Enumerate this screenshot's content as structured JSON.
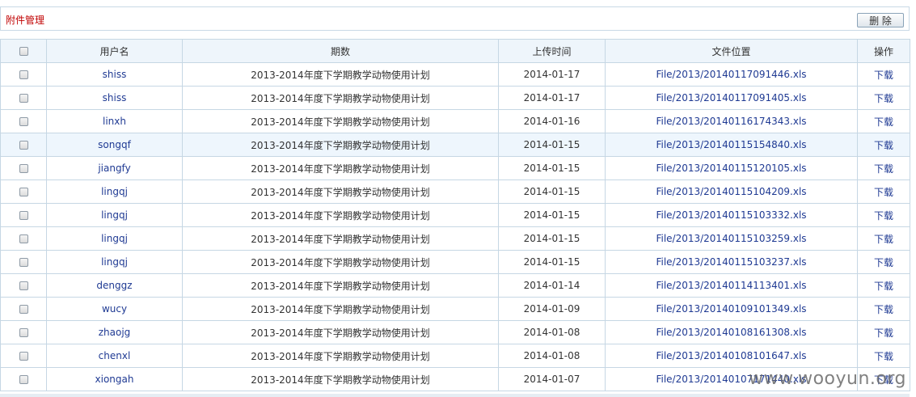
{
  "topbar": {
    "title": "附件管理",
    "delete_label": "删 除"
  },
  "table": {
    "headers": [
      "用户名",
      "期数",
      "上传时间",
      "文件位置",
      "操作"
    ],
    "rows": [
      {
        "user": "shiss",
        "period": "2013-2014年度下学期教学动物使用计划",
        "date": "2014-01-17",
        "file": "File/2013/20140117091446.xls",
        "action": "下载"
      },
      {
        "user": "shiss",
        "period": "2013-2014年度下学期教学动物使用计划",
        "date": "2014-01-17",
        "file": "File/2013/20140117091405.xls",
        "action": "下载"
      },
      {
        "user": "linxh",
        "period": "2013-2014年度下学期教学动物使用计划",
        "date": "2014-01-16",
        "file": "File/2013/20140116174343.xls",
        "action": "下载"
      },
      {
        "user": "songqf",
        "period": "2013-2014年度下学期教学动物使用计划",
        "date": "2014-01-15",
        "file": "File/2013/20140115154840.xls",
        "action": "下载"
      },
      {
        "user": "jiangfy",
        "period": "2013-2014年度下学期教学动物使用计划",
        "date": "2014-01-15",
        "file": "File/2013/20140115120105.xls",
        "action": "下载"
      },
      {
        "user": "lingqj",
        "period": "2013-2014年度下学期教学动物使用计划",
        "date": "2014-01-15",
        "file": "File/2013/20140115104209.xls",
        "action": "下载"
      },
      {
        "user": "lingqj",
        "period": "2013-2014年度下学期教学动物使用计划",
        "date": "2014-01-15",
        "file": "File/2013/20140115103332.xls",
        "action": "下载"
      },
      {
        "user": "lingqj",
        "period": "2013-2014年度下学期教学动物使用计划",
        "date": "2014-01-15",
        "file": "File/2013/20140115103259.xls",
        "action": "下载"
      },
      {
        "user": "lingqj",
        "period": "2013-2014年度下学期教学动物使用计划",
        "date": "2014-01-15",
        "file": "File/2013/20140115103237.xls",
        "action": "下载"
      },
      {
        "user": "denggz",
        "period": "2013-2014年度下学期教学动物使用计划",
        "date": "2014-01-14",
        "file": "File/2013/20140114113401.xls",
        "action": "下载"
      },
      {
        "user": "wucy",
        "period": "2013-2014年度下学期教学动物使用计划",
        "date": "2014-01-09",
        "file": "File/2013/20140109101349.xls",
        "action": "下载"
      },
      {
        "user": "zhaojg",
        "period": "2013-2014年度下学期教学动物使用计划",
        "date": "2014-01-08",
        "file": "File/2013/20140108161308.xls",
        "action": "下载"
      },
      {
        "user": "chenxl",
        "period": "2013-2014年度下学期教学动物使用计划",
        "date": "2014-01-08",
        "file": "File/2013/20140108101647.xls",
        "action": "下载"
      },
      {
        "user": "xiongah",
        "period": "2013-2014年度下学期教学动物使用计划",
        "date": "2014-01-07",
        "file": "File/2013/20140107171440.xls",
        "action": "下载"
      }
    ],
    "highlighted_row": 3
  },
  "watermark": "www.wooyun.org",
  "colors": {
    "title_red": "#c00000",
    "link_blue": "#1f3a93",
    "header_bg": "#eef5fb",
    "border": "#c6d7e4"
  }
}
